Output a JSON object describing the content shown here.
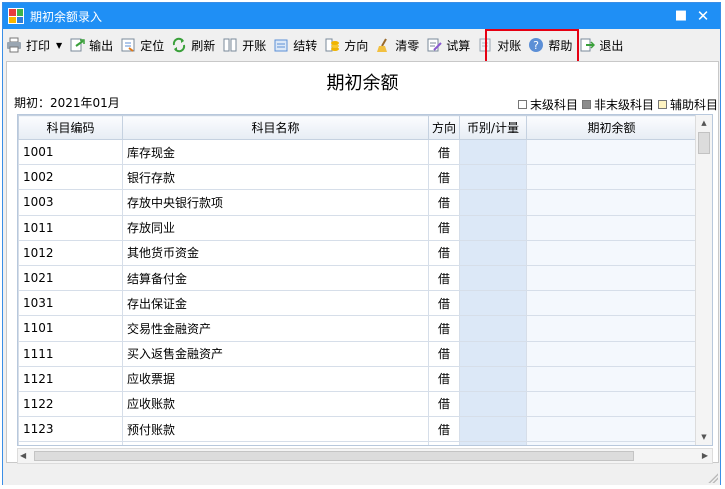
{
  "window": {
    "title": "期初余额录入",
    "maximize_icon": "maximize-icon",
    "close_icon": "close-icon"
  },
  "toolbar": {
    "print": "打印",
    "export": "输出",
    "locate": "定位",
    "refresh": "刷新",
    "open_account": "开账",
    "carry_forward": "结转",
    "direction": "方向",
    "clear": "清零",
    "trial": "试算",
    "reconcile": "对账",
    "help": "帮助",
    "exit": "退出"
  },
  "header": {
    "title": "期初余额",
    "period": "期初：2021年01月"
  },
  "legend": [
    "末级科目",
    "非末级科目",
    "辅助科目"
  ],
  "legend_colors": [
    "#ffffff",
    "#8c8c8c",
    "#fff4c2"
  ],
  "table": {
    "columns": [
      "科目编码",
      "科目名称",
      "方向",
      "币别/计量",
      "期初余额"
    ],
    "rows": [
      {
        "code": "1001",
        "name": "库存现金",
        "dir": "借"
      },
      {
        "code": "1002",
        "name": "银行存款",
        "dir": "借"
      },
      {
        "code": "1003",
        "name": "存放中央银行款项",
        "dir": "借"
      },
      {
        "code": "1011",
        "name": "存放同业",
        "dir": "借"
      },
      {
        "code": "1012",
        "name": "其他货币资金",
        "dir": "借"
      },
      {
        "code": "1021",
        "name": "结算备付金",
        "dir": "借"
      },
      {
        "code": "1031",
        "name": "存出保证金",
        "dir": "借"
      },
      {
        "code": "1101",
        "name": "交易性金融资产",
        "dir": "借"
      },
      {
        "code": "1111",
        "name": "买入返售金融资产",
        "dir": "借"
      },
      {
        "code": "1121",
        "name": "应收票据",
        "dir": "借"
      },
      {
        "code": "1122",
        "name": "应收账款",
        "dir": "借"
      },
      {
        "code": "1123",
        "name": "预付账款",
        "dir": "借"
      },
      {
        "code": "",
        "name": "",
        "dir": ""
      }
    ]
  }
}
